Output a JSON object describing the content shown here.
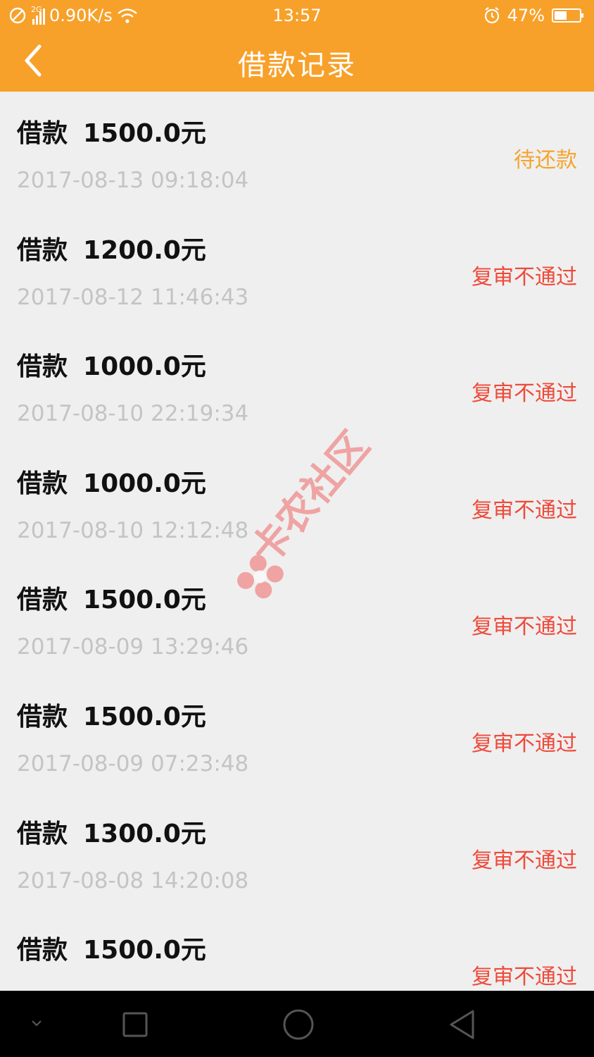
{
  "status_bar": {
    "net_type": "2G",
    "speed": "0.90K/s",
    "time": "13:57",
    "battery": "47%"
  },
  "header": {
    "title": "借款记录"
  },
  "records": [
    {
      "label": "借款",
      "amount": "1500.0元",
      "date": "2017-08-13 09:18:04",
      "status": "待还款",
      "status_color": "#f5a32c"
    },
    {
      "label": "借款",
      "amount": "1200.0元",
      "date": "2017-08-12 11:46:43",
      "status": "复审不通过",
      "status_color": "#ef4a3a"
    },
    {
      "label": "借款",
      "amount": "1000.0元",
      "date": "2017-08-10 22:19:34",
      "status": "复审不通过",
      "status_color": "#ef4a3a"
    },
    {
      "label": "借款",
      "amount": "1000.0元",
      "date": "2017-08-10 12:12:48",
      "status": "复审不通过",
      "status_color": "#ef4a3a"
    },
    {
      "label": "借款",
      "amount": "1500.0元",
      "date": "2017-08-09 13:29:46",
      "status": "复审不通过",
      "status_color": "#ef4a3a"
    },
    {
      "label": "借款",
      "amount": "1500.0元",
      "date": "2017-08-09 07:23:48",
      "status": "复审不通过",
      "status_color": "#ef4a3a"
    },
    {
      "label": "借款",
      "amount": "1300.0元",
      "date": "2017-08-08 14:20:08",
      "status": "复审不通过",
      "status_color": "#ef4a3a"
    },
    {
      "label": "借款",
      "amount": "1500.0元",
      "date": "",
      "status": "复审不通过",
      "status_color": "#ef4a3a"
    }
  ],
  "watermark": {
    "text": "卡农社区"
  },
  "colors": {
    "header_bg": "#f7a12a",
    "list_bg": "#efefef",
    "date_text": "#c4c4c4"
  },
  "icons": [
    "dnd-icon",
    "signal-icon",
    "wifi-icon",
    "alarm-icon",
    "battery-icon",
    "back-arrow-icon",
    "nav-down-icon",
    "nav-recent-icon",
    "nav-home-icon",
    "nav-back-icon"
  ]
}
